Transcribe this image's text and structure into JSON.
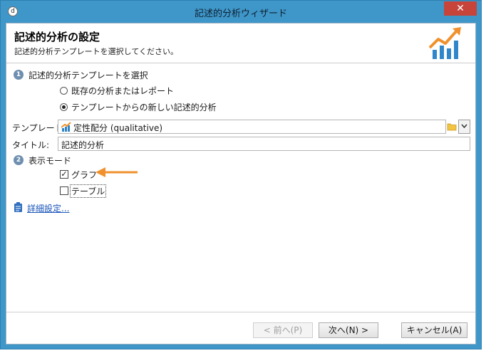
{
  "window": {
    "title": "記述的分析ウィザード",
    "close_glyph": "✕",
    "app_icon": "d"
  },
  "header": {
    "title": "記述的分析の設定",
    "subtitle": "記述的分析テンプレートを選択してください。"
  },
  "step1": {
    "number": "1",
    "label": "記述的分析テンプレートを選択",
    "options": [
      {
        "label": "既存の分析またはレポート",
        "selected": false
      },
      {
        "label": "テンプレートからの新しい記述的分析",
        "selected": true
      }
    ]
  },
  "form": {
    "template_label": "テンプレート:",
    "template_value": "定性配分 (qualitative)",
    "title_label": "タイトル:",
    "title_value": "記述的分析"
  },
  "step2": {
    "number": "2",
    "label": "表示モード",
    "checks": [
      {
        "label": "グラフ",
        "checked": true
      },
      {
        "label": "テーブル",
        "checked": false
      }
    ]
  },
  "advanced_link": "詳細設定...",
  "footer": {
    "prev": "< 前へ(P)",
    "next": "次へ(N) >",
    "cancel": "キャンセル(A)"
  },
  "colors": {
    "accent_arrow": "#f0912e",
    "chart_bars": "#2f86c9",
    "close_button": "#c7443a",
    "window_frame": "#3f96c8"
  }
}
